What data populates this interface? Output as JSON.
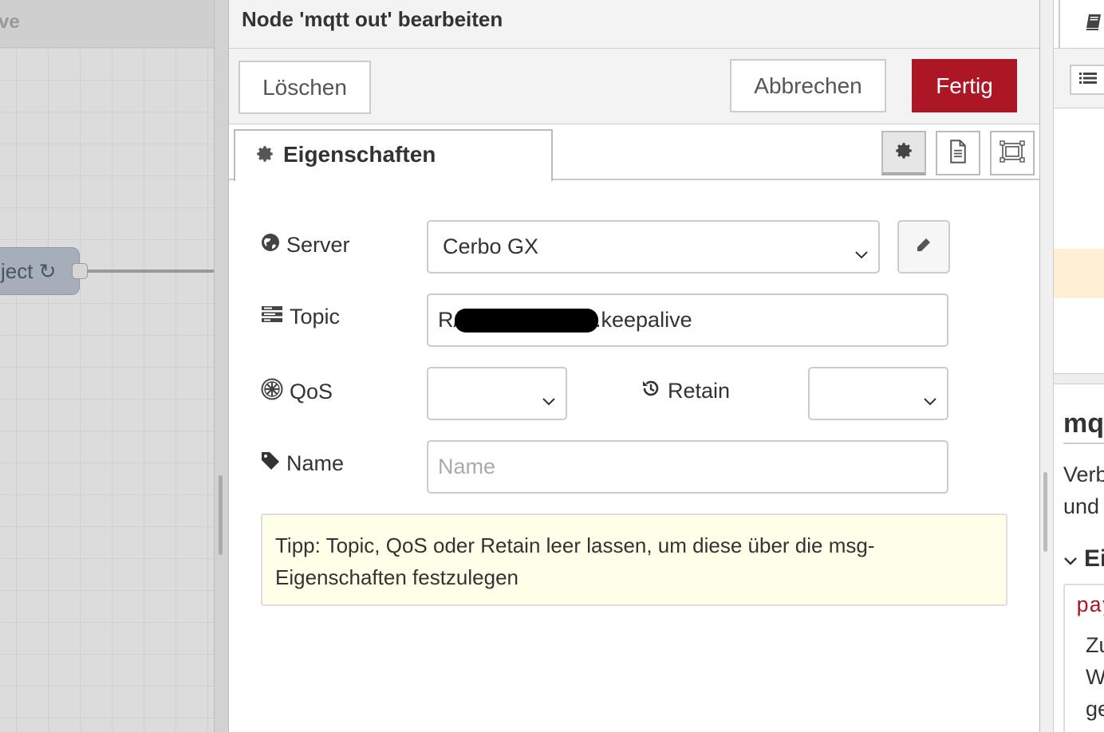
{
  "workspace": {
    "header_text": "ve",
    "node_label": "ject ↻"
  },
  "tray": {
    "title": "Node 'mqtt out' bearbeiten",
    "buttons": {
      "delete": "Löschen",
      "cancel": "Abbrechen",
      "done": "Fertig"
    },
    "tab": {
      "label": "Eigenschaften"
    },
    "form": {
      "server": {
        "label": "Server",
        "value": "Cerbo GX"
      },
      "topic": {
        "label": "Topic",
        "value_prefix": "R/",
        "value_suffix": ".keepalive"
      },
      "qos": {
        "label": "QoS",
        "value": ""
      },
      "retain": {
        "label": "Retain",
        "value": ""
      },
      "name": {
        "label": "Name",
        "placeholder": "Name",
        "value": ""
      }
    },
    "tip": "Tipp: Topic, QoS oder Retain leer lassen, um diese über die msg-Eigenschaften festzulegen"
  },
  "sidebar": {
    "help_title": "mqtt out",
    "text_1": "Verbindet",
    "text_2": "und",
    "section": "Eingaben",
    "code": "payload",
    "body_1": "Zu",
    "body_2": "Wi",
    "body_3": "ge"
  },
  "colors": {
    "primary_button": "#ad1625",
    "tip_background": "#fefee9",
    "highlight": "#ffefd5"
  }
}
